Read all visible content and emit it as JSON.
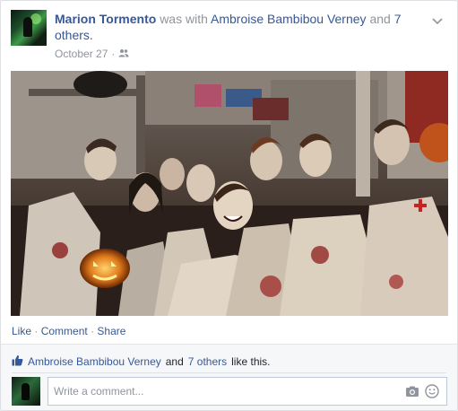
{
  "post": {
    "author": "Marion Tormento",
    "with_text": "was with",
    "tagged_person": "Ambroise Bambibou Verney",
    "and_text": "and",
    "others_link": "7 others",
    "period": ".",
    "date": "October 27",
    "date_separator": "·",
    "audience_icon": "friends-icon",
    "menu_icon": "chevron-down-icon"
  },
  "photo": {
    "subject": "costumed group"
  },
  "actions": {
    "like": "Like",
    "comment": "Comment",
    "share": "Share",
    "separator": "·"
  },
  "likes": {
    "icon": "thumbs-up-icon",
    "person": "Ambroise Bambibou Verney",
    "and_text": "and",
    "others": "7 others",
    "suffix": "like this."
  },
  "comment": {
    "placeholder": "Write a comment...",
    "camera_icon": "camera-icon",
    "emoji_icon": "smiley-icon"
  },
  "colors": {
    "link": "#365899",
    "muted": "#90949c",
    "footer_bg": "#f6f7f9"
  }
}
